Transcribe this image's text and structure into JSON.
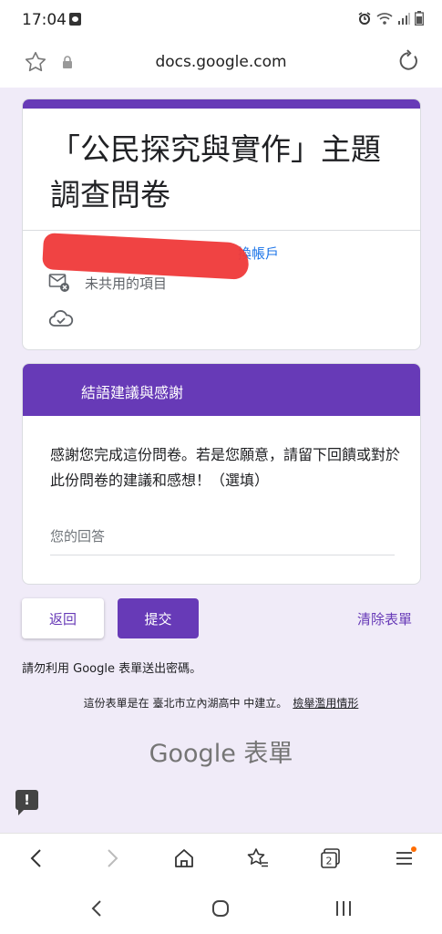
{
  "status_bar": {
    "time": "17:04"
  },
  "browser": {
    "url": "docs.google.com",
    "tab_count": "2"
  },
  "form": {
    "title": "「公民探究與實作」主題調查問卷",
    "switch_account": "換帳戶",
    "not_shared": "未共用的項目"
  },
  "section": {
    "header": "結語建議與感謝",
    "question": "感謝您完成這份問卷。若是您願意，請留下回饋或對於此份問卷的建議和感想！（選填）",
    "answer_placeholder": "您的回答"
  },
  "actions": {
    "back": "返回",
    "submit": "提交",
    "clear": "清除表單"
  },
  "footer": {
    "password_warning": "請勿利用 Google 表單送出密碼。",
    "created_by": "這份表單是在 臺北市立內湖高中 中建立。",
    "report_abuse": "檢舉濫用情形",
    "brand": "Google 表單"
  },
  "icons": [
    "notification-icon",
    "alarm-icon",
    "wifi-icon",
    "signal-icon",
    "battery-icon",
    "star-icon",
    "lock-icon",
    "reload-icon",
    "mail-off-icon",
    "cloud-check-icon",
    "report-icon",
    "back-arrow-icon",
    "forward-arrow-icon",
    "home-icon",
    "bookmarks-icon",
    "tabs-icon",
    "menu-icon"
  ],
  "colors": {
    "accent": "#673ab7",
    "page_bg": "#f0ebf8",
    "link": "#1a73e8",
    "menu_badge": "#ff6d00"
  }
}
